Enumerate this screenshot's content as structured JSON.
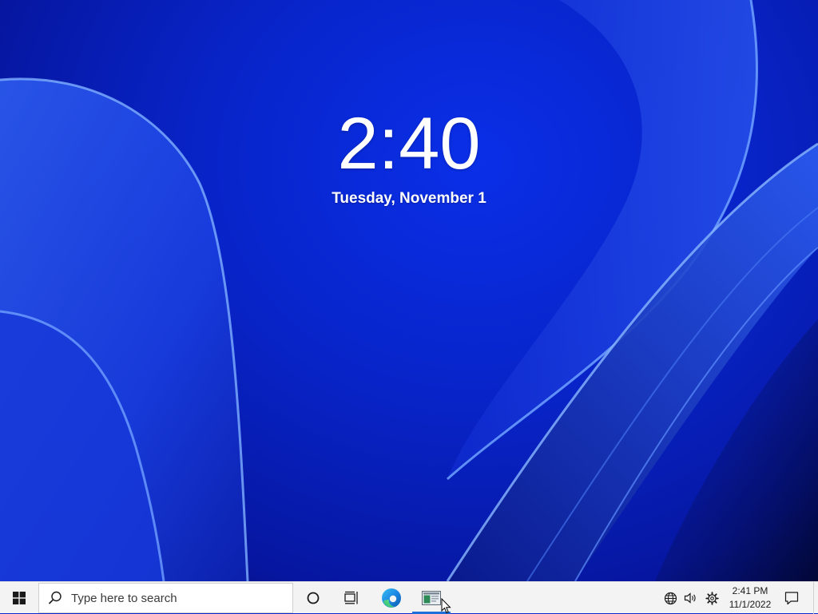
{
  "lock_screen": {
    "time": "2:40",
    "date": "Tuesday, November 1"
  },
  "taskbar": {
    "start_icon": "windows-logo-icon",
    "search_placeholder": "Type here to search",
    "pinned": [
      {
        "name": "cortana",
        "icon": "circle-icon"
      },
      {
        "name": "task-view",
        "icon": "task-view-icon"
      },
      {
        "name": "microsoft-edge",
        "icon": "edge-icon"
      },
      {
        "name": "running-app",
        "icon": "app-window-icon",
        "active": true
      }
    ],
    "tray": {
      "network_icon": "globe-icon",
      "volume_icon": "speaker-icon",
      "settings_icon": "gear-icon",
      "time": "2:41 PM",
      "date": "11/1/2022",
      "notification_icon": "chat-bubble-icon"
    }
  },
  "colors": {
    "wallpaper_base": "#0824c8",
    "wallpaper_ribbon": "#3a6cf0",
    "taskbar_bg": "#f3f3f3",
    "accent": "#1e6fd9"
  }
}
